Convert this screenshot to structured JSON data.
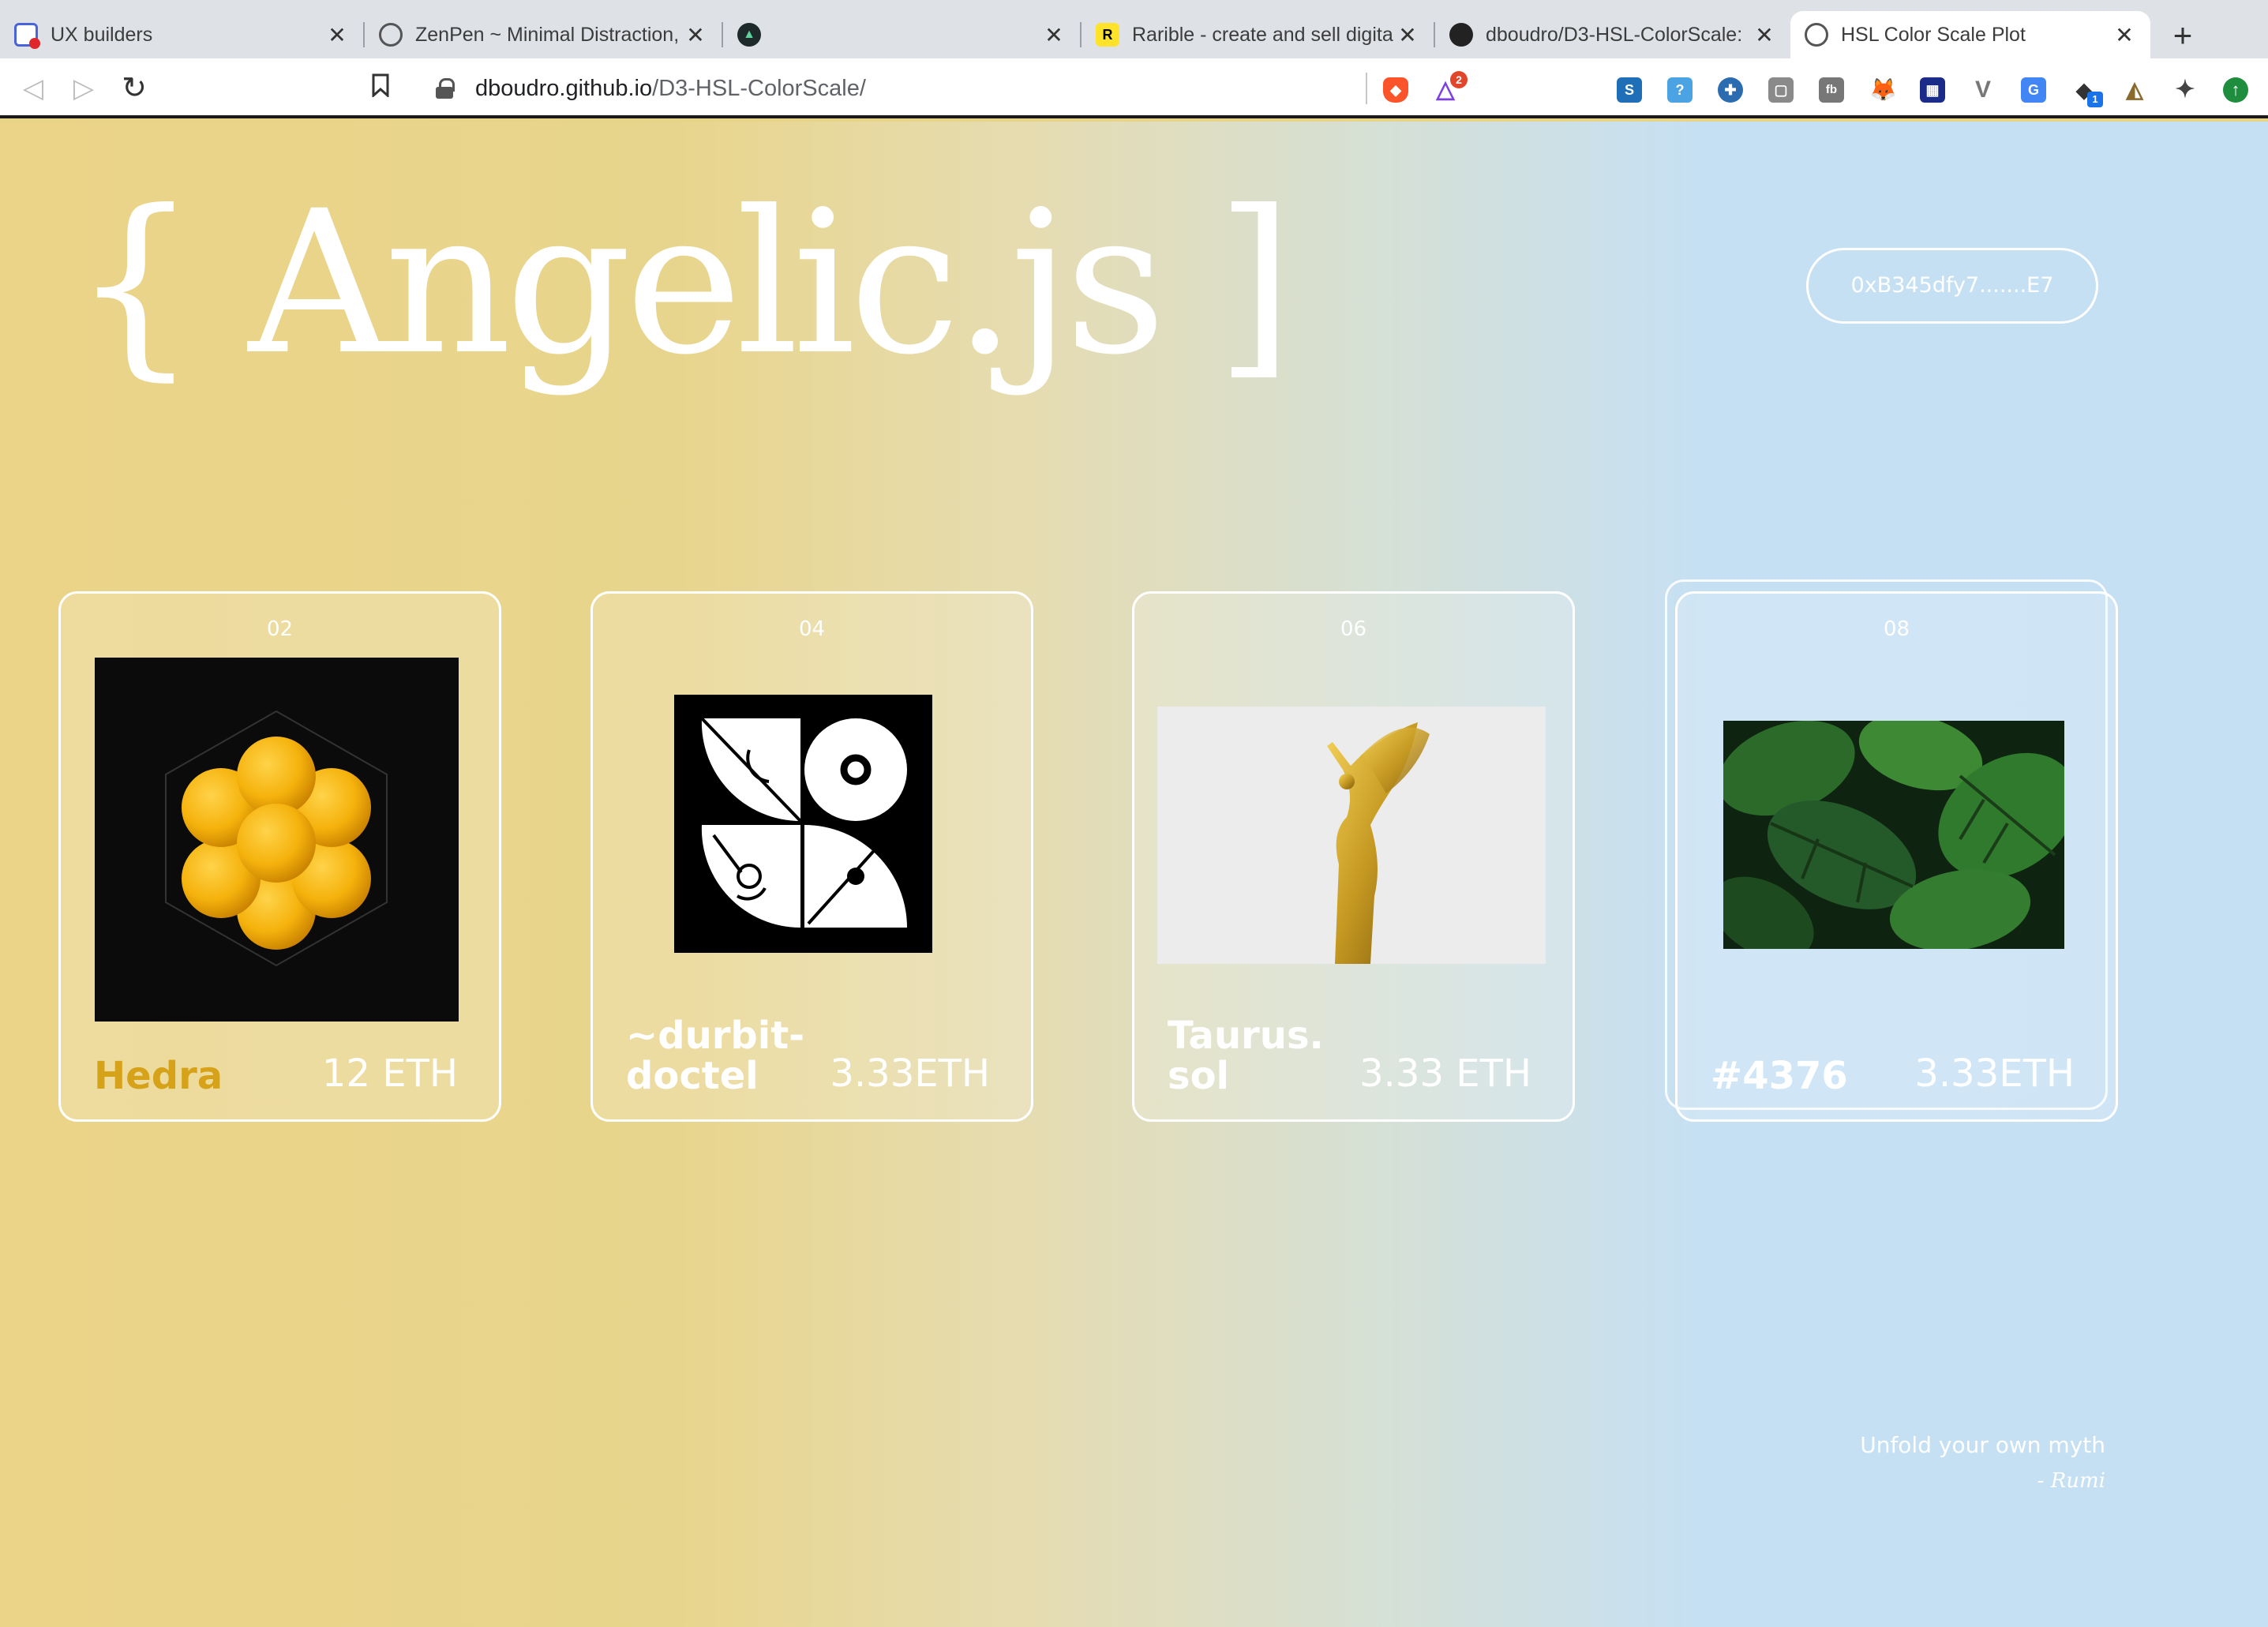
{
  "browser": {
    "tabs": [
      {
        "title": "UX builders",
        "favicon": "calendar-icon"
      },
      {
        "title": "ZenPen ~ Minimal Distraction,",
        "favicon": "globe-icon"
      },
      {
        "title": "",
        "favicon": "triangle-logo-icon"
      },
      {
        "title": "Rarible - create and sell digita",
        "favicon": "rarible-icon"
      },
      {
        "title": "dboudro/D3-HSL-ColorScale:",
        "favicon": "github-icon"
      },
      {
        "title": "HSL Color Scale Plot",
        "favicon": "globe-icon"
      }
    ],
    "address": {
      "host": "dboudro.github.io",
      "path": "/D3-HSL-ColorScale/"
    },
    "brave_badge": "2",
    "extension_badge": "1"
  },
  "page": {
    "logo": "{ Angelic.js ]",
    "wallet": "0xB345dfy7.......E7",
    "cards": [
      {
        "num": "02",
        "name": "Hedra",
        "price": "12 ETH",
        "art": "yellow-spheres-hexagon-art"
      },
      {
        "num": "04",
        "name_line1": "~durbit-",
        "name_line2": "doctel",
        "price": "3.33ETH",
        "art": "black-white-geometric-art"
      },
      {
        "num": "06",
        "name_line1": "Taurus.",
        "name_line2": "sol",
        "price": "3.33 ETH",
        "art": "golden-angel-statue-art"
      },
      {
        "num": "08",
        "name": "#4376",
        "price": "3.33ETH",
        "art": "monstera-leaves-art"
      }
    ],
    "quote": {
      "text": "Unfold your own myth",
      "author": "- Rumi"
    },
    "colors": {
      "hedra_gold": "#d6a21a",
      "bg_left": "#ebd488",
      "bg_right": "#c5e0f3"
    }
  }
}
